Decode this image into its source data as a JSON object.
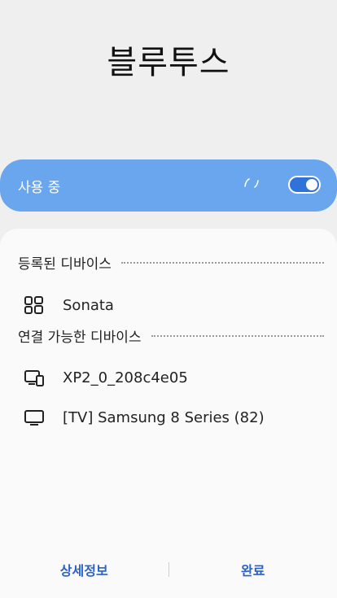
{
  "header": {
    "title": "블루투스"
  },
  "master_switch": {
    "label": "사용 중",
    "enabled": true,
    "accent_color": "#6aa6ee",
    "toggle_color": "#2f73d9"
  },
  "sections": {
    "paired": {
      "title": "등록된 디바이스",
      "devices": [
        {
          "name": "Sonata",
          "icon": "car-dashboard-icon"
        }
      ]
    },
    "available": {
      "title": "연결 가능한 디바이스",
      "devices": [
        {
          "name": "XP2_0_208c4e05",
          "icon": "tablet-phone-icon"
        },
        {
          "name": "[TV] Samsung 8 Series (82)",
          "icon": "tv-icon"
        }
      ]
    }
  },
  "footer": {
    "details_label": "상세정보",
    "done_label": "완료",
    "link_color": "#2a62c9"
  }
}
